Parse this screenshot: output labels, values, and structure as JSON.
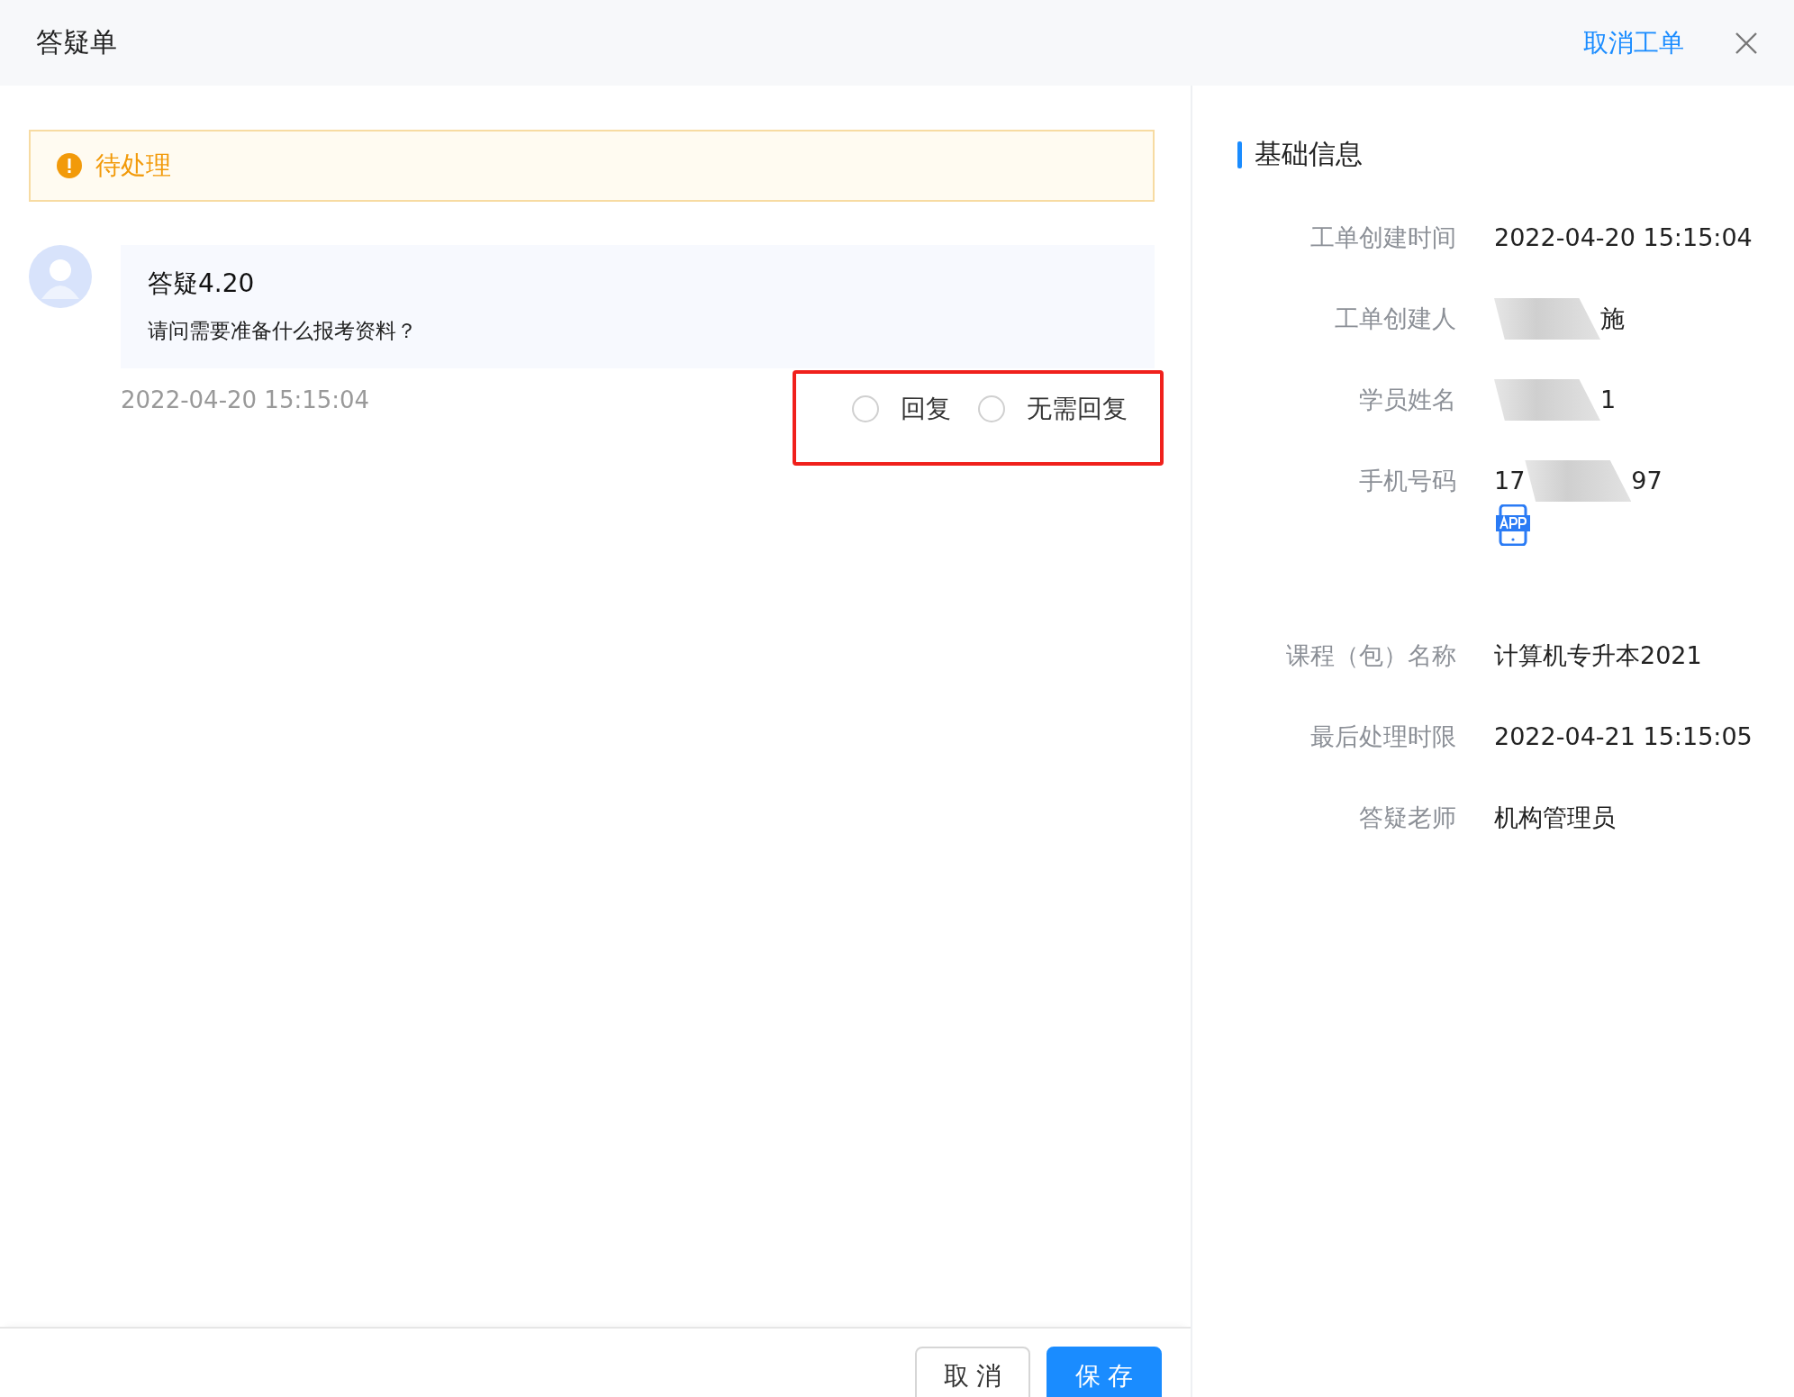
{
  "window": {
    "title": "答疑单",
    "cancel_order_link": "取消工单"
  },
  "status": {
    "label": "待处理"
  },
  "message": {
    "title": "答疑4.20",
    "body": "请问需要准备什么报考资料？",
    "time": "2022-04-20 15:15:04",
    "reply_options": [
      {
        "label": "回复",
        "selected": false
      },
      {
        "label": "无需回复",
        "selected": false
      }
    ]
  },
  "basic_info": {
    "title": "基础信息",
    "rows": [
      {
        "label": "工单创建时间",
        "kind": "text",
        "value": "2022-04-20 15:15:04"
      },
      {
        "label": "工单创建人",
        "kind": "masked",
        "after": "施"
      },
      {
        "label": "学员姓名",
        "kind": "masked",
        "after": "1"
      },
      {
        "label": "手机号码",
        "kind": "masked",
        "before": "17",
        "after": "97",
        "app_badge": true
      },
      {
        "label": "课程（包）名称",
        "kind": "text",
        "value": "计算机专升本2021"
      },
      {
        "label": "最后处理时限",
        "kind": "text",
        "value": "2022-04-21 15:15:05"
      },
      {
        "label": "答疑老师",
        "kind": "text",
        "value": "机构管理员"
      }
    ]
  },
  "footer": {
    "buttons": [
      {
        "label": "取 消",
        "kind": "secondary"
      },
      {
        "label": "保 存",
        "kind": "primary"
      }
    ]
  }
}
